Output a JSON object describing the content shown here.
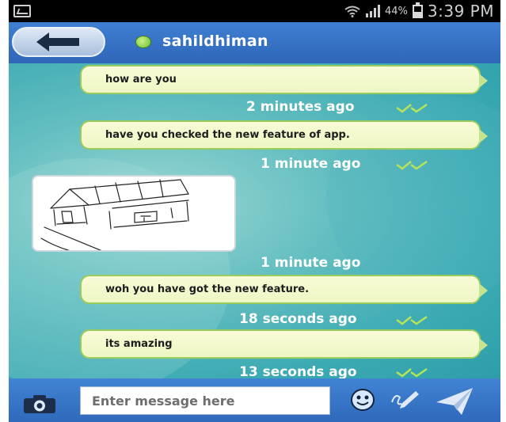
{
  "status_bar": {
    "icons": [
      "gallery-icon",
      "wifi-icon",
      "signal-icon",
      "battery-icon"
    ],
    "battery_percent": "44%",
    "time": "3:39 PM"
  },
  "header": {
    "back_icon": "back-arrow-icon",
    "presence": "online",
    "contact_name": "sahildhiman",
    "colors": {
      "header": "#3a77cc",
      "presence": "#8bd14a"
    }
  },
  "messages": [
    {
      "type": "text",
      "text": "how are you",
      "time": "2 minutes ago",
      "status_icon": "double-check-icon"
    },
    {
      "type": "text",
      "text": "have you checked the new feature of app.",
      "time": "1 minute ago",
      "status_icon": "double-check-icon"
    },
    {
      "type": "image",
      "image": "hand-drawn-house-sketch",
      "time": "1 minute ago"
    },
    {
      "type": "text",
      "text": "woh you have got the new feature.",
      "time": "18 seconds ago",
      "status_icon": "double-check-icon"
    },
    {
      "type": "text",
      "text": "its amazing",
      "time": "13 seconds ago",
      "status_icon": "double-check-icon"
    }
  ],
  "composer": {
    "camera_icon": "camera-icon",
    "placeholder": "Enter message here",
    "value": "",
    "emoji_icon": "emoji-icon",
    "draw_icon": "draw-icon",
    "send_icon": "send-icon"
  },
  "colors": {
    "bubble_fill": "#f3f8cc",
    "bubble_border": "#9acb5c",
    "tick": "#b6e35a",
    "chat_background": "#4fb4ba",
    "bottom_bar": "#3a77cc"
  }
}
